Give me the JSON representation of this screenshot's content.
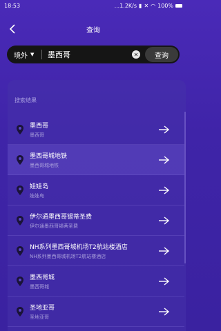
{
  "status_bar": {
    "time": "18:53",
    "speed": "...1.2K/s",
    "battery": "100%"
  },
  "header": {
    "title": "查询"
  },
  "search": {
    "region": "境外",
    "query": "墨西哥",
    "button_label": "查询"
  },
  "results": {
    "label": "搜索结果",
    "items": [
      {
        "name": "墨西哥",
        "sub": "墨西哥"
      },
      {
        "name": "墨西哥城地铁",
        "sub": "墨西哥城地铁"
      },
      {
        "name": "娃娃岛",
        "sub": "娃娃岛"
      },
      {
        "name": "伊尔通墨西哥锡蒂圣费",
        "sub": "伊尔通墨西哥锡蒂圣费"
      },
      {
        "name": "NH系列墨西哥城机场T2航站楼酒店",
        "sub": "NH系列墨西哥城机场T2航站楼酒店"
      },
      {
        "name": "墨西哥城",
        "sub": "墨西哥城"
      },
      {
        "name": "圣地亚哥",
        "sub": "圣地亚哥"
      }
    ]
  },
  "colors": {
    "background": "#4a2ab8",
    "search_bar": "#151515",
    "search_button": "#3a3a3a"
  },
  "icons": [
    "back-arrow-icon",
    "caret-down-icon",
    "clear-icon",
    "location-pin-icon",
    "right-arrow-icon"
  ]
}
